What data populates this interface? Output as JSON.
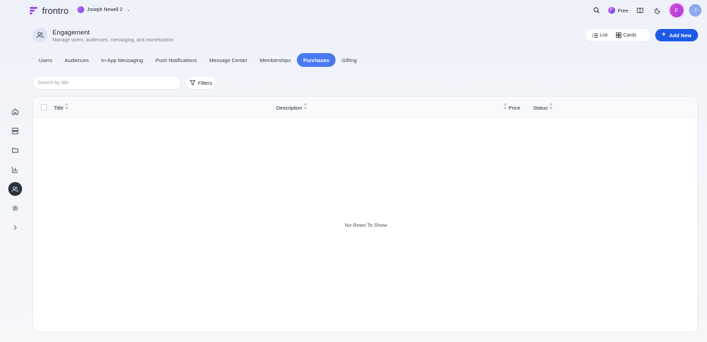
{
  "app": {
    "name": "frontro"
  },
  "workspace": {
    "name": "Joseph Newell 2"
  },
  "topbar": {
    "plan_label": "Free",
    "plan_initial": "F",
    "user_initial_1": "F",
    "user_initial_2": "J"
  },
  "header": {
    "title": "Engagement",
    "subtitle": "Manage users, audiences, messaging, and monetization",
    "view_list": "List",
    "view_cards": "Cards",
    "add_new": "Add New"
  },
  "tabs": [
    {
      "label": "Users"
    },
    {
      "label": "Audiences"
    },
    {
      "label": "In-App Messaging"
    },
    {
      "label": "Push Notifications"
    },
    {
      "label": "Message Center"
    },
    {
      "label": "Memberships"
    },
    {
      "label": "Purchases",
      "active": true
    },
    {
      "label": "Gifting"
    }
  ],
  "search": {
    "placeholder": "Search by title"
  },
  "filters": {
    "label": "Filters"
  },
  "table": {
    "columns": [
      {
        "label": "Title"
      },
      {
        "label": "Description"
      },
      {
        "label": "Price"
      },
      {
        "label": "Status"
      }
    ],
    "empty_text": "No Rows To Show"
  },
  "colors": {
    "accent": "#1e5ae8",
    "active_tab": "#4a78f0",
    "rail_active": "#2c3340"
  }
}
